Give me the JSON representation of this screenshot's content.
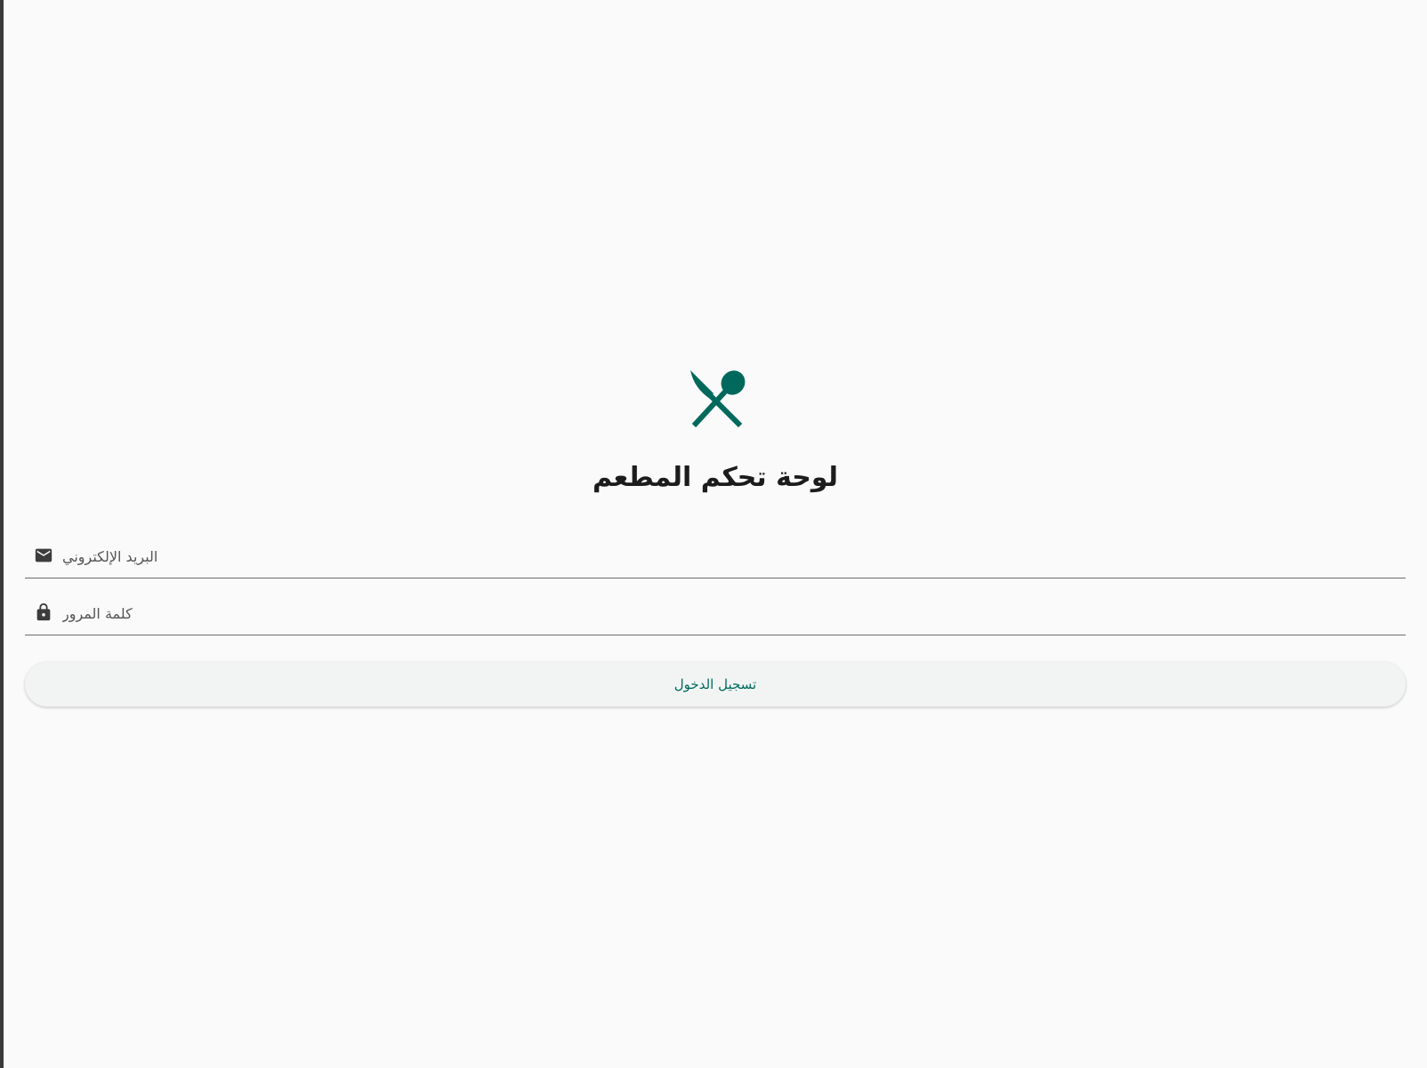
{
  "app": {
    "title": "لوحة تحكم المطعم",
    "logo_icon": "restaurant-icon",
    "accent_color": "#00695c"
  },
  "form": {
    "email": {
      "placeholder": "البريد الإلكتروني",
      "value": "",
      "icon": "email-icon"
    },
    "password": {
      "placeholder": "كلمة المرور",
      "value": "",
      "icon": "lock-icon"
    },
    "login_label": "تسجيل الدخول"
  }
}
